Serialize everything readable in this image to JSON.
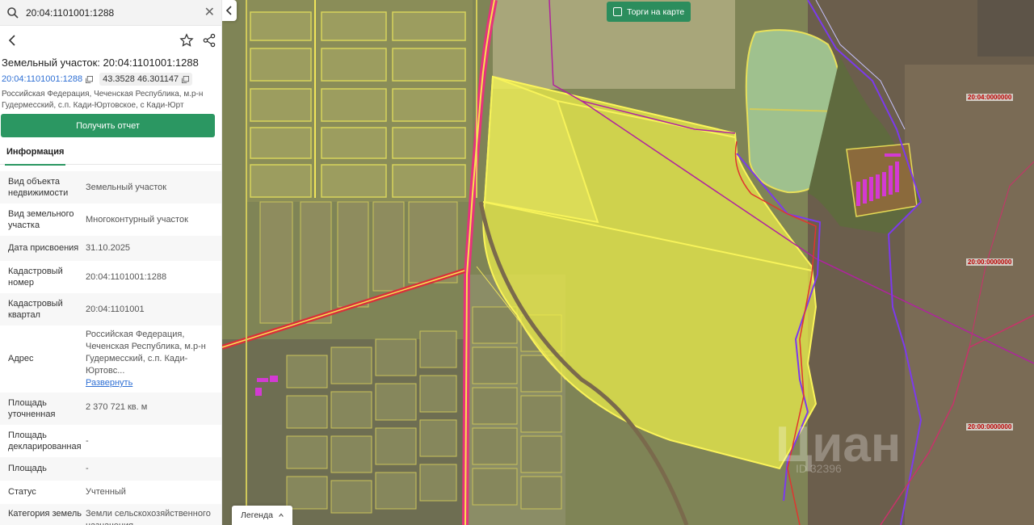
{
  "search": {
    "value": "20:04:1101001:1288"
  },
  "parcel": {
    "title": "Земельный участок: 20:04:1101001:1288",
    "cadastral_link": "20:04:1101001:1288",
    "coords": "43.3528 46.301147",
    "address": "Российская Федерация, Чеченская Республика, м.р-н Гудермесский, с.п. Кади-Юртовское, с Кади-Юрт",
    "report_button": "Получить отчет"
  },
  "tabs": [
    {
      "label": "Информация"
    }
  ],
  "info_rows": [
    {
      "key": "Вид объекта недвижимости",
      "value": "Земельный участок"
    },
    {
      "key": "Вид земельного участка",
      "value": "Многоконтурный участок"
    },
    {
      "key": "Дата присвоения",
      "value": "31.10.2025"
    },
    {
      "key": "Кадастровый номер",
      "value": "20:04:1101001:1288"
    },
    {
      "key": "Кадастровый квартал",
      "value": "20:04:1101001"
    },
    {
      "key": "Адрес",
      "value": "Российская Федерация, Чеченская Республика, м.р-н Гудермесский, с.п. Кади-Юртовс...",
      "link": "Развернуть"
    },
    {
      "key": "Площадь уточненная",
      "value": "2 370 721 кв. м"
    },
    {
      "key": "Площадь декларированная",
      "value": "-"
    },
    {
      "key": "Площадь",
      "value": "-"
    },
    {
      "key": "Статус",
      "value": "Учтенный"
    },
    {
      "key": "Категория земель",
      "value": "Земли сельскохозяйственного назначения"
    }
  ],
  "map": {
    "torgi_label": "Торги на карте",
    "legend_label": "Легенда",
    "cadastral_labels": [
      "20:04:0000000",
      "20:00:0000000",
      "20:00:0000000"
    ],
    "watermark": "Циан",
    "watermark_id": "ID 32396"
  },
  "colors": {
    "accent": "#2b9762",
    "link": "#2e6fd4",
    "parcel_fill": "#eef04a",
    "boundary_red": "#d8232a",
    "boundary_purple": "#8a2be2"
  }
}
